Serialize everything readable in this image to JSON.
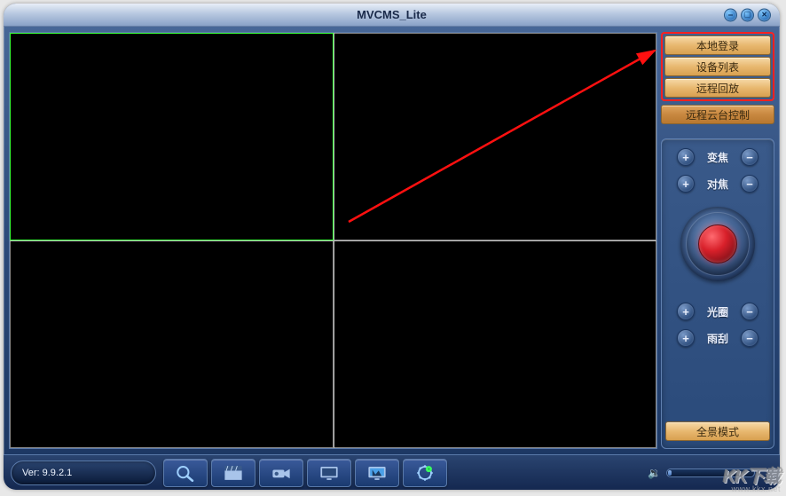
{
  "title": "MVCMS_Lite",
  "sidebar": {
    "login": "本地登录",
    "devices": "设备列表",
    "playback": "远程回放",
    "ptz_ctrl": "远程云台控制",
    "panorama": "全景模式"
  },
  "ptz": {
    "zoom": "变焦",
    "focus": "对焦",
    "iris": "光圈",
    "wiper": "雨刮"
  },
  "version_label": "Ver: 9.9.2.1",
  "watermark": {
    "brand": "KK下载",
    "url": "www.kkx.net"
  },
  "volume_percent": 4
}
